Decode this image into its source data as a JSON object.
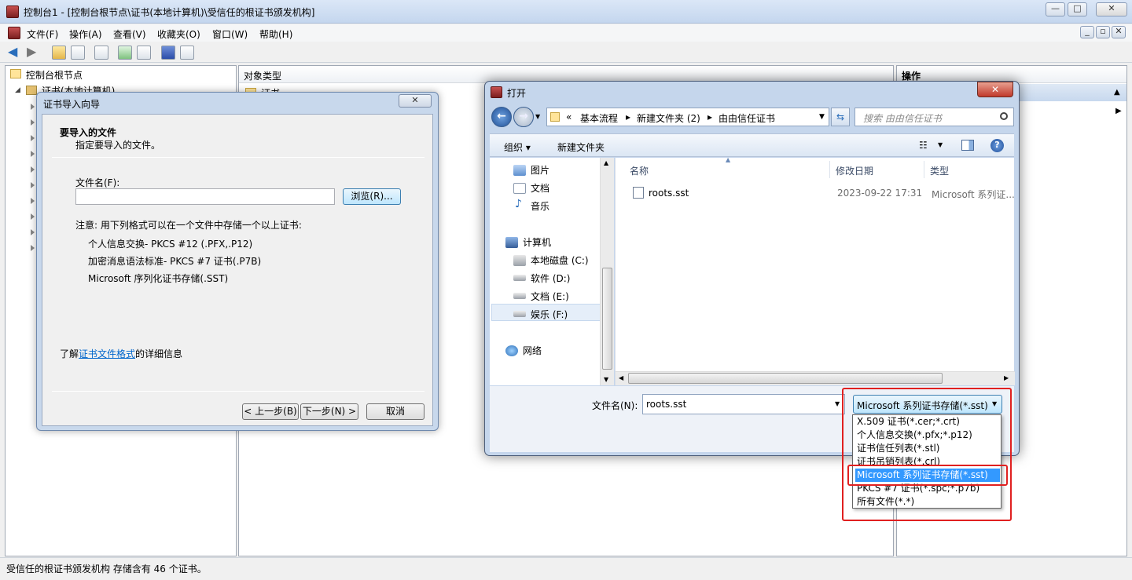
{
  "window": {
    "title": "控制台1 - [控制台根节点\\证书(本地计算机)\\受信任的根证书颁发机构]",
    "controls": [
      "—",
      "□",
      "✕"
    ]
  },
  "menubar": [
    "文件(F)",
    "操作(A)",
    "查看(V)",
    "收藏夹(O)",
    "窗口(W)",
    "帮助(H)"
  ],
  "mdi_controls": [
    "_",
    "▫",
    "✕"
  ],
  "tree": {
    "root": "控制台根节点",
    "child": "证书(本地计算机)"
  },
  "middle": {
    "header": "对象类型",
    "row": "证书"
  },
  "actions": {
    "header": "操作"
  },
  "status": "受信任的根证书颁发机构 存储含有 46 个证书。",
  "wizard": {
    "title": "证书导入向导",
    "close": "✕",
    "heading": "要导入的文件",
    "subheading": "指定要导入的文件。",
    "file_label": "文件名(F):",
    "file_value": "",
    "browse": "浏览(R)...",
    "note": "注意: 用下列格式可以在一个文件中存储一个以上证书:",
    "formats": [
      "个人信息交换- PKCS #12 (.PFX,.P12)",
      "加密消息语法标准- PKCS #7 证书(.P7B)",
      "Microsoft 序列化证书存储(.SST)"
    ],
    "learn_prefix": "了解",
    "learn_link": "证书文件格式",
    "learn_suffix": "的详细信息",
    "back": "< 上一步(B)",
    "next": "下一步(N) >",
    "cancel": "取消"
  },
  "open": {
    "title": "打开",
    "close": "✕",
    "breadcrumb": [
      "«",
      "基本流程",
      "新建文件夹 (2)",
      "由由信任证书"
    ],
    "search_placeholder": "搜索 由由信任证书",
    "organize": "组织 ▾",
    "new_folder": "新建文件夹",
    "nav": [
      "图片",
      "文档",
      "音乐",
      "计算机",
      "本地磁盘 (C:)",
      "软件 (D:)",
      "文档 (E:)",
      "娱乐 (F:)",
      "网络"
    ],
    "columns": [
      "名称",
      "修改日期",
      "类型"
    ],
    "files": [
      {
        "name": "roots.sst",
        "date": "2023-09-22 17:31",
        "type": "Microsoft 系列证..."
      }
    ],
    "filename_label": "文件名(N):",
    "filename_value": "roots.sst",
    "filetype_selected": "Microsoft 系列证书存储(*.sst)",
    "filetype_options": [
      "X.509 证书(*.cer;*.crt)",
      "个人信息交换(*.pfx;*.p12)",
      "证书信任列表(*.stl)",
      "证书吊销列表(*.crl)",
      "Microsoft 系列证书存储(*.sst)",
      "PKCS #7 证书(*.spc;*.p7b)",
      "所有文件(*.*)"
    ],
    "selected_option_index": 4
  }
}
